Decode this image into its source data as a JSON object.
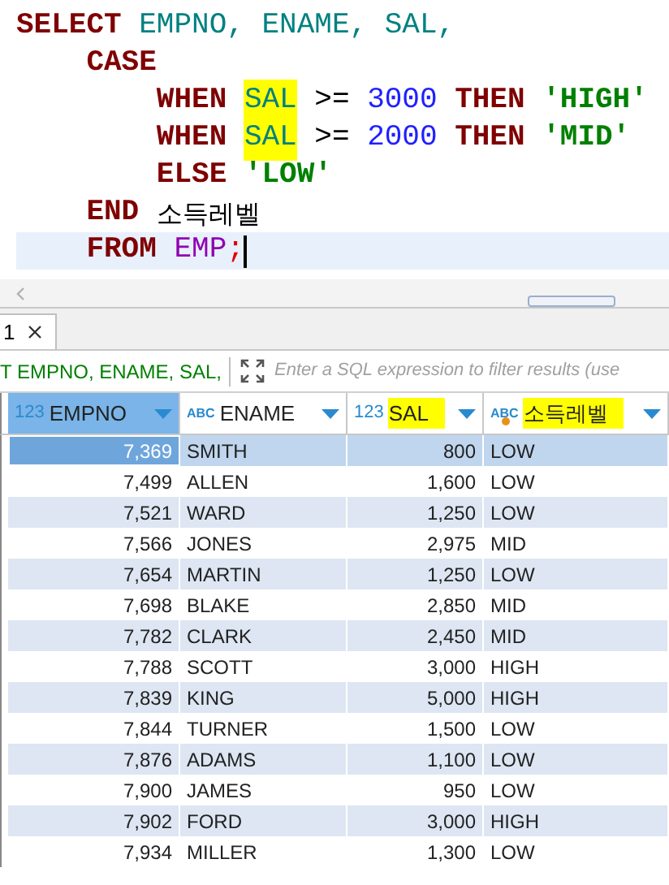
{
  "editor": {
    "lines": [
      {
        "current": false,
        "tokens": [
          {
            "kind": "keyword",
            "text": "SELECT "
          },
          {
            "kind": "column",
            "text": "EMPNO, ENAME, SAL,"
          }
        ]
      },
      {
        "current": false,
        "tokens": [
          {
            "kind": "keyword",
            "text": "    CASE"
          }
        ]
      },
      {
        "current": false,
        "tokens": [
          {
            "kind": "keyword",
            "text": "        WHEN "
          },
          {
            "kind": "column",
            "text": "SAL",
            "highlighted": true
          },
          {
            "kind": "operator",
            "text": " >= "
          },
          {
            "kind": "number",
            "text": "3000"
          },
          {
            "kind": "keyword",
            "text": " THEN "
          },
          {
            "kind": "string",
            "text": "'HIGH'"
          }
        ]
      },
      {
        "current": false,
        "tokens": [
          {
            "kind": "keyword",
            "text": "        WHEN "
          },
          {
            "kind": "column",
            "text": "SAL",
            "highlighted": true
          },
          {
            "kind": "operator",
            "text": " >= "
          },
          {
            "kind": "number",
            "text": "2000"
          },
          {
            "kind": "keyword",
            "text": " THEN "
          },
          {
            "kind": "string",
            "text": "'MID'"
          }
        ]
      },
      {
        "current": false,
        "tokens": [
          {
            "kind": "keyword",
            "text": "        ELSE "
          },
          {
            "kind": "string",
            "text": "'LOW'"
          }
        ]
      },
      {
        "current": false,
        "tokens": [
          {
            "kind": "keyword",
            "text": "    END "
          },
          {
            "kind": "alias",
            "text": "소득레벨"
          }
        ]
      },
      {
        "current": true,
        "tokens": [
          {
            "kind": "keyword",
            "text": "    FROM "
          },
          {
            "kind": "table",
            "text": "EMP"
          },
          {
            "kind": "punct",
            "text": ";"
          }
        ]
      }
    ]
  },
  "results_tab": {
    "label": "1",
    "selected": true
  },
  "filter": {
    "query": "T EMPNO, ENAME, SAL,",
    "placeholder": "Enter a SQL expression to filter results (use"
  },
  "table": {
    "columns": [
      {
        "type_label": "123",
        "kind": "number",
        "name": "EMPNO",
        "selected": true,
        "highlighted": false
      },
      {
        "type_label": "ABC",
        "kind": "text",
        "name": "ENAME",
        "selected": false,
        "highlighted": false
      },
      {
        "type_label": "123",
        "kind": "number",
        "name": "SAL",
        "selected": false,
        "highlighted": true
      },
      {
        "type_label": "ABC",
        "kind": "text",
        "name": "소득레벨",
        "selected": false,
        "highlighted": true
      }
    ],
    "rows": [
      {
        "selected": true,
        "cells": [
          "7,369",
          "SMITH",
          "800",
          "LOW"
        ]
      },
      {
        "selected": false,
        "cells": [
          "7,499",
          "ALLEN",
          "1,600",
          "LOW"
        ]
      },
      {
        "selected": false,
        "cells": [
          "7,521",
          "WARD",
          "1,250",
          "LOW"
        ]
      },
      {
        "selected": false,
        "cells": [
          "7,566",
          "JONES",
          "2,975",
          "MID"
        ]
      },
      {
        "selected": false,
        "cells": [
          "7,654",
          "MARTIN",
          "1,250",
          "LOW"
        ]
      },
      {
        "selected": false,
        "cells": [
          "7,698",
          "BLAKE",
          "2,850",
          "MID"
        ]
      },
      {
        "selected": false,
        "cells": [
          "7,782",
          "CLARK",
          "2,450",
          "MID"
        ]
      },
      {
        "selected": false,
        "cells": [
          "7,788",
          "SCOTT",
          "3,000",
          "HIGH"
        ]
      },
      {
        "selected": false,
        "cells": [
          "7,839",
          "KING",
          "5,000",
          "HIGH"
        ]
      },
      {
        "selected": false,
        "cells": [
          "7,844",
          "TURNER",
          "1,500",
          "LOW"
        ]
      },
      {
        "selected": false,
        "cells": [
          "7,876",
          "ADAMS",
          "1,100",
          "LOW"
        ]
      },
      {
        "selected": false,
        "cells": [
          "7,900",
          "JAMES",
          "950",
          "LOW"
        ]
      },
      {
        "selected": false,
        "cells": [
          "7,902",
          "FORD",
          "3,000",
          "HIGH"
        ]
      },
      {
        "selected": false,
        "cells": [
          "7,934",
          "MILLER",
          "1,300",
          "LOW"
        ]
      }
    ]
  }
}
